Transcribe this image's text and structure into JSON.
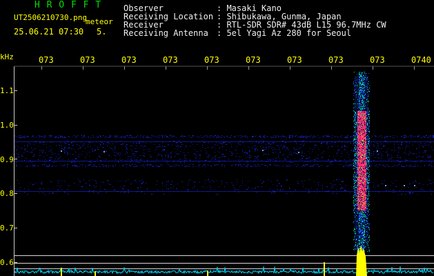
{
  "app": {
    "name": "H R O F F T"
  },
  "file": {
    "name": "UT2506210730.png",
    "tag": "meteor",
    "date": "25.06.21 07:30",
    "count": "5."
  },
  "info": [
    {
      "label": "Observer",
      "value": ": Masaki Kano"
    },
    {
      "label": "Receiving Location",
      "value": ": Shibukawa, Gunma, Japan"
    },
    {
      "label": "Receiver",
      "value": ": RTL-SDR SDR# 43dB L15 96.7MHz CW"
    },
    {
      "label": "Receiving Antenna",
      "value": ": 5el Yagi Az 280 for Seoul"
    }
  ],
  "axis": {
    "unit": "kHz",
    "time_ticks": [
      "073",
      "073",
      "073",
      "073",
      "073",
      "073",
      "073",
      "073",
      "073",
      "0740"
    ],
    "freq_ticks": [
      "1.1",
      "1.0",
      "0.9",
      "0.8",
      "0.7",
      "0.6"
    ]
  },
  "colors": {
    "background": "#000000",
    "title": "#00e000",
    "labels": "#ffff00",
    "text": "#f0f0f0",
    "meteor": "#ff2a7a",
    "noise": "#1a2cff",
    "spectrum": "#00d8ff"
  }
}
